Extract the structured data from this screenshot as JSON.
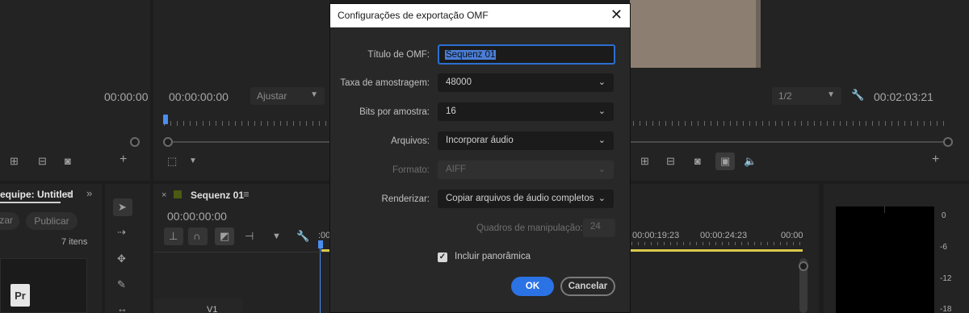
{
  "source_monitor": {
    "timecode_left": "00:00:00",
    "timecode_in": "00:00:00:00",
    "fit_label": "Ajustar"
  },
  "program_monitor": {
    "scale_label": "1/2",
    "timecode": "00:02:03:21"
  },
  "project_panel": {
    "title": "equipe: Untitled",
    "button_left": "zar",
    "publish_label": "Publicar",
    "item_count": "7 itens",
    "file_icon_label": "Pr"
  },
  "timeline": {
    "sequence_name": "Sequenz 01",
    "timecode": "00:00:00:00",
    "ruler_labels": [
      "00:00:19:23",
      "00:00:24:23",
      "00:00"
    ],
    "track_label": "V1"
  },
  "audio_meter": {
    "scale": [
      "0",
      "-6",
      "-12",
      "-18"
    ]
  },
  "dialog": {
    "title": "Configurações de exportação OMF",
    "omf_title_label": "Título de OMF:",
    "omf_title_value": "Sequenz 01",
    "sample_rate_label": "Taxa de amostragem:",
    "sample_rate_value": "48000",
    "bits_label": "Bits por amostra:",
    "bits_value": "16",
    "files_label": "Arquivos:",
    "files_value": "Incorporar áudio",
    "format_label": "Formato:",
    "format_value": "AIFF",
    "render_label": "Renderizar:",
    "render_value": "Copiar arquivos de áudio completos",
    "handles_label": "Quadros de manipulação:",
    "handles_value": "24",
    "pan_label": "Incluir panorâmica",
    "pan_checked": true,
    "ok_label": "OK",
    "cancel_label": "Cancelar"
  },
  "colors": {
    "accent": "#2b72e4",
    "playhead": "#4a8ef0",
    "work_area": "#d8c94a"
  }
}
